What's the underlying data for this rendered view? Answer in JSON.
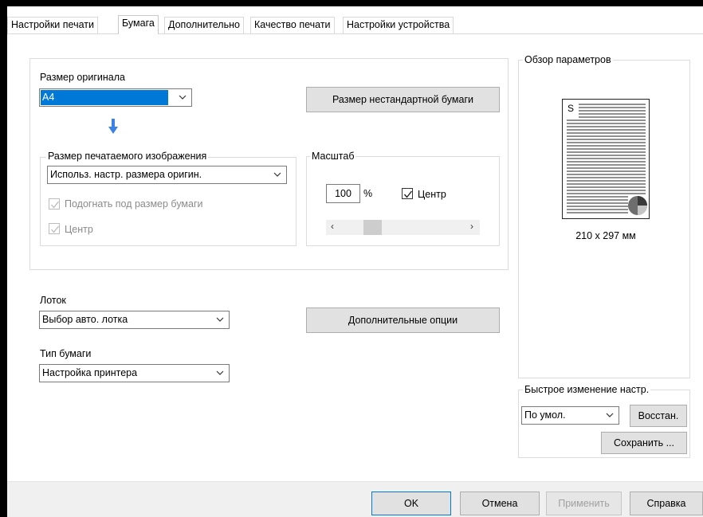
{
  "tabs": [
    {
      "label": "Настройки печати"
    },
    {
      "label": "Бумага"
    },
    {
      "label": "Дополнительно"
    },
    {
      "label": "Качество печати"
    },
    {
      "label": "Настройки устройства"
    }
  ],
  "original_size": {
    "label": "Размер оригинала",
    "selected": "A4"
  },
  "custom_paper_button": "Размер нестандартной бумаги",
  "print_image_size": {
    "legend": "Размер печатаемого изображения",
    "selected": "Использ. настр. размера оригин.",
    "fit_to_paper": {
      "label": "Подогнать под размер бумаги",
      "checked": true,
      "enabled": false
    },
    "center": {
      "label": "Центр",
      "checked": true,
      "enabled": false
    }
  },
  "scale": {
    "legend": "Масштаб",
    "value": "100",
    "unit": "%",
    "center": {
      "label": "Центр",
      "checked": true
    }
  },
  "tray": {
    "label": "Лоток",
    "selected": "Выбор авто. лотка"
  },
  "paper_type": {
    "label": "Тип бумаги",
    "selected": "Настройка принтера"
  },
  "additional_options_button": "Дополнительные опции",
  "preview": {
    "legend": "Обзор параметров",
    "page_letter": "S",
    "size_text": "210 x 297 мм"
  },
  "quick_settings": {
    "legend": "Быстрое изменение настр.",
    "selected": "По умол.",
    "restore_button": "Восстан.",
    "save_button": "Сохранить ..."
  },
  "footer": {
    "ok": "OK",
    "cancel": "Отмена",
    "apply": "Применить",
    "help": "Справка"
  },
  "colors": {
    "selection": "#0078d7",
    "arrow": "#3c82e6"
  }
}
